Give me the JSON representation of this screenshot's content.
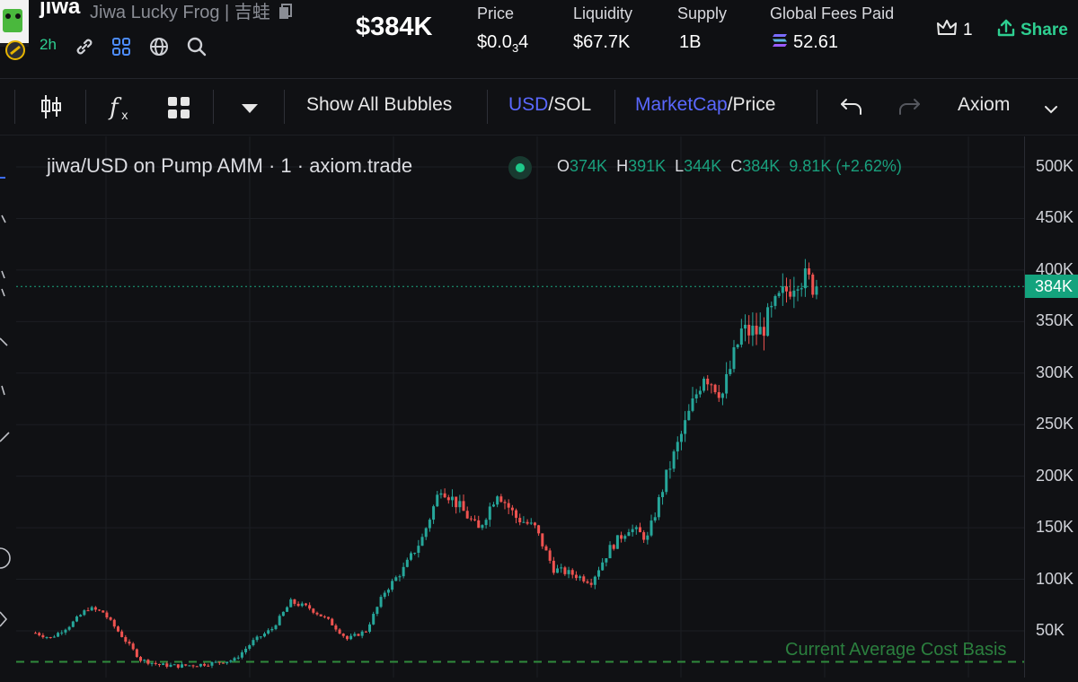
{
  "header": {
    "ticker": "jiwa",
    "full_name": "Jiwa Lucky Frog | 吉蛙",
    "age": "2h",
    "market_cap": "$384K",
    "stats": [
      {
        "label": "Price",
        "value_main": "$0.0",
        "value_sub": "3",
        "value_end": "4"
      },
      {
        "label": "Liquidity",
        "value": "$67.7K"
      },
      {
        "label": "Supply",
        "value": "1B"
      }
    ],
    "fees_label": "Global Fees Paid",
    "fees_value": "52.61",
    "watch_count": "1",
    "share_label": "Share",
    "colors": {
      "accent_green": "#2ecf91",
      "header_bg": "#0f1013"
    }
  },
  "toolbar": {
    "bubbles_label": "Show All Bubbles",
    "currency_active": "USD",
    "currency_sep": "/",
    "currency_other": "SOL",
    "metric_active": "MarketCap",
    "metric_sep": "/",
    "metric_other": "Price",
    "source_label": "Axiom",
    "icons": [
      "candles-icon",
      "fx-icon",
      "grid-icon",
      "caret-down-icon",
      "undo-icon",
      "redo-icon",
      "chevron-down-icon"
    ]
  },
  "legend": {
    "title": "jiwa/USD on Pump AMM · 1 · axiom.trade",
    "o_label": "O",
    "o_value": "374K",
    "h_label": "H",
    "h_value": "391K",
    "l_label": "L",
    "l_value": "344K",
    "c_label": "C",
    "c_value": "384K",
    "change": "9.81K (+2.62%)"
  },
  "chart_data": {
    "type": "candlestick",
    "y_ticks": [
      "500K",
      "450K",
      "400K",
      "350K",
      "300K",
      "250K",
      "200K",
      "150K",
      "100K",
      "50K"
    ],
    "ylim": [
      25000,
      520000
    ],
    "current_price": 384000,
    "current_price_label": "384K",
    "cost_basis_label": "Current Average Cost Basis",
    "cost_basis_value": 20000,
    "up_color": "#26a69a",
    "down_color": "#ef5350",
    "close_path": [
      [
        0,
        48000
      ],
      [
        4,
        43000
      ],
      [
        9,
        55000
      ],
      [
        14,
        72000
      ],
      [
        18,
        68000
      ],
      [
        23,
        45000
      ],
      [
        28,
        22000
      ],
      [
        33,
        17000
      ],
      [
        38,
        16000
      ],
      [
        43,
        17000
      ],
      [
        48,
        19000
      ],
      [
        53,
        22000
      ],
      [
        58,
        40000
      ],
      [
        63,
        52000
      ],
      [
        68,
        78000
      ],
      [
        73,
        72000
      ],
      [
        78,
        60000
      ],
      [
        83,
        42000
      ],
      [
        88,
        50000
      ],
      [
        93,
        88000
      ],
      [
        98,
        110000
      ],
      [
        103,
        140000
      ],
      [
        108,
        190000
      ],
      [
        113,
        170000
      ],
      [
        118,
        148000
      ],
      [
        123,
        185000
      ],
      [
        128,
        160000
      ],
      [
        133,
        150000
      ],
      [
        138,
        110000
      ],
      [
        143,
        105000
      ],
      [
        148,
        98000
      ],
      [
        153,
        130000
      ],
      [
        158,
        150000
      ],
      [
        163,
        140000
      ],
      [
        168,
        200000
      ],
      [
        173,
        250000
      ],
      [
        178,
        300000
      ],
      [
        183,
        280000
      ],
      [
        188,
        340000
      ],
      [
        193,
        340000
      ],
      [
        198,
        370000
      ],
      [
        203,
        395000
      ],
      [
        208,
        384000
      ]
    ]
  }
}
